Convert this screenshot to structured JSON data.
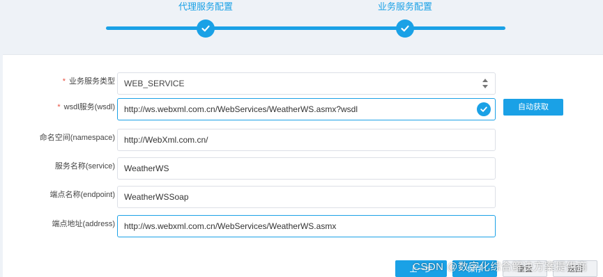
{
  "stepper": {
    "steps": [
      {
        "label": "代理服务配置",
        "status": "done"
      },
      {
        "label": "业务服务配置",
        "status": "done"
      }
    ],
    "accent_color": "#1aa1e6"
  },
  "form": {
    "service_type": {
      "label": "业务服务类型",
      "required": true,
      "value": "WEB_SERVICE"
    },
    "wsdl": {
      "label": "wsdl服务(wsdl)",
      "required": true,
      "value": "http://ws.webxml.com.cn/WebServices/WeatherWS.asmx?wsdl",
      "valid": true
    },
    "auto_fetch_label": "自动获取",
    "namespace": {
      "label": "命名空间(namespace)",
      "value": "http://WebXml.com.cn/"
    },
    "service": {
      "label": "服务名称(service)",
      "value": "WeatherWS"
    },
    "endpoint": {
      "label": "端点名称(endpoint)",
      "value": "WeatherWSSoap"
    },
    "address": {
      "label": "端点地址(address)",
      "value": "http://ws.webxml.com.cn/WebServices/WeatherWS.asmx"
    }
  },
  "footer": {
    "prev_label": "上一步",
    "save_label": "保存",
    "reset_label": "重置",
    "cancel_label": "返回"
  },
  "watermark": "CSDN @数字化综合解决方案提供商",
  "icons": {
    "step_check": "check-icon",
    "valid_check": "check-circle-icon",
    "select_arrows": "select-arrows-icon"
  }
}
